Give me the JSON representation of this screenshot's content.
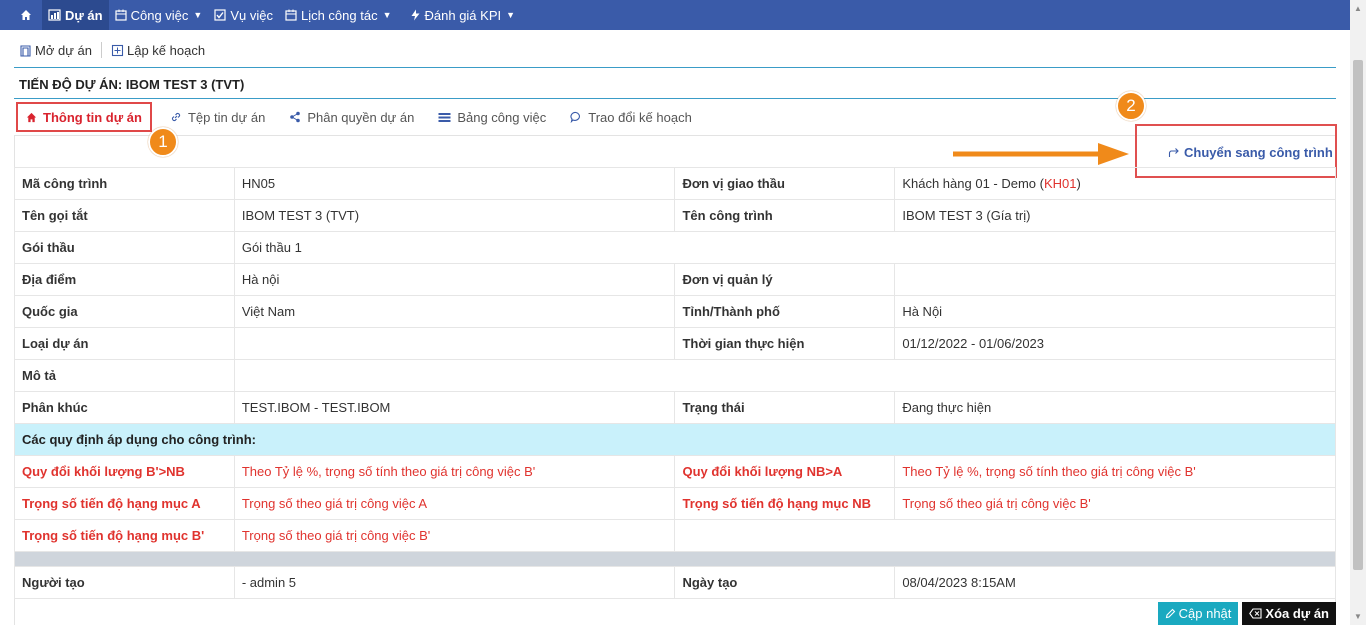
{
  "nav": {
    "items": [
      {
        "label": "Dự án",
        "icon": "chart-icon",
        "active": true
      },
      {
        "label": "Công việc",
        "icon": "calendar-icon",
        "dropdown": true
      },
      {
        "label": "Vụ việc",
        "icon": "checkbox-icon"
      },
      {
        "label": "Lịch công tác",
        "icon": "calendar-icon",
        "dropdown": true
      },
      {
        "label": "Đánh giá KPI",
        "icon": "bolt-icon",
        "dropdown": true
      }
    ]
  },
  "toolbar": {
    "open_project": "Mở dự án",
    "plan": "Lập kế hoạch"
  },
  "page": {
    "title": "TIẾN ĐỘ DỰ ÁN: IBOM TEST 3 (TVT)"
  },
  "tabs": [
    {
      "label": "Thông tin dự án"
    },
    {
      "label": "Tệp tin dự án"
    },
    {
      "label": "Phân quyền dự án"
    },
    {
      "label": "Bảng công việc"
    },
    {
      "label": "Trao đổi kế hoạch"
    }
  ],
  "badges": {
    "one": "1",
    "two": "2"
  },
  "convert_link": "Chuyển sang công trình",
  "info": {
    "ma_cong_trinh": {
      "label": "Mã công trình",
      "value": "HN05"
    },
    "don_vi_giao_thau": {
      "label": "Đơn vị giao thầu",
      "value": "Khách hàng 01 - Demo (",
      "code": "KH01",
      "close": ")"
    },
    "ten_goi_tat": {
      "label": "Tên gọi tắt",
      "value": "IBOM TEST 3 (TVT)"
    },
    "ten_cong_trinh": {
      "label": "Tên công trình",
      "value": "IBOM TEST 3 (Gía trị)"
    },
    "goi_thau": {
      "label": "Gói thầu",
      "value": "Gói thầu 1"
    },
    "dia_diem": {
      "label": "Địa điểm",
      "value": "Hà nội"
    },
    "don_vi_quan_ly": {
      "label": "Đơn vị quản lý",
      "value": ""
    },
    "quoc_gia": {
      "label": "Quốc gia",
      "value": "Việt Nam"
    },
    "tinh_thanh_pho": {
      "label": "Tỉnh/Thành phố",
      "value": "Hà Nội"
    },
    "loai_du_an": {
      "label": "Loại dự án",
      "value": ""
    },
    "thoi_gian": {
      "label": "Thời gian thực hiện",
      "value": "01/12/2022 - 01/06/2023"
    },
    "mo_ta": {
      "label": "Mô tả",
      "value": ""
    },
    "phan_khuc": {
      "label": "Phân khúc",
      "value": "TEST.IBOM - TEST.IBOM"
    },
    "trang_thai": {
      "label": "Trạng thái",
      "value": "Đang thực hiện"
    },
    "section_title": "Các quy định áp dụng cho công trình:",
    "quy_doi_b_nb": {
      "label": "Quy đổi khối lượng B'>NB",
      "value": "Theo Tỷ lệ %, trọng số tính theo giá trị công việc B'"
    },
    "quy_doi_nb_a": {
      "label": "Quy đổi khối lượng NB>A",
      "value": "Theo Tỷ lệ %, trọng số tính theo giá trị công việc B'"
    },
    "trong_so_a": {
      "label": "Trọng số tiến độ hạng mục A",
      "value": "Trọng số theo giá trị công việc A"
    },
    "trong_so_nb": {
      "label": "Trọng số tiến độ hạng mục NB",
      "value": "Trọng số theo giá trị công việc B'"
    },
    "trong_so_b": {
      "label": "Trọng số tiến độ hạng mục B'",
      "value": "Trọng số theo giá trị công việc B'"
    },
    "nguoi_tao": {
      "label": "Người tạo",
      "value": "- admin 5"
    },
    "ngay_tao": {
      "label": "Ngày tạo",
      "value": "08/04/2023 8:15AM"
    }
  },
  "actions": {
    "update": "Cập nhật",
    "delete": "Xóa dự án"
  }
}
